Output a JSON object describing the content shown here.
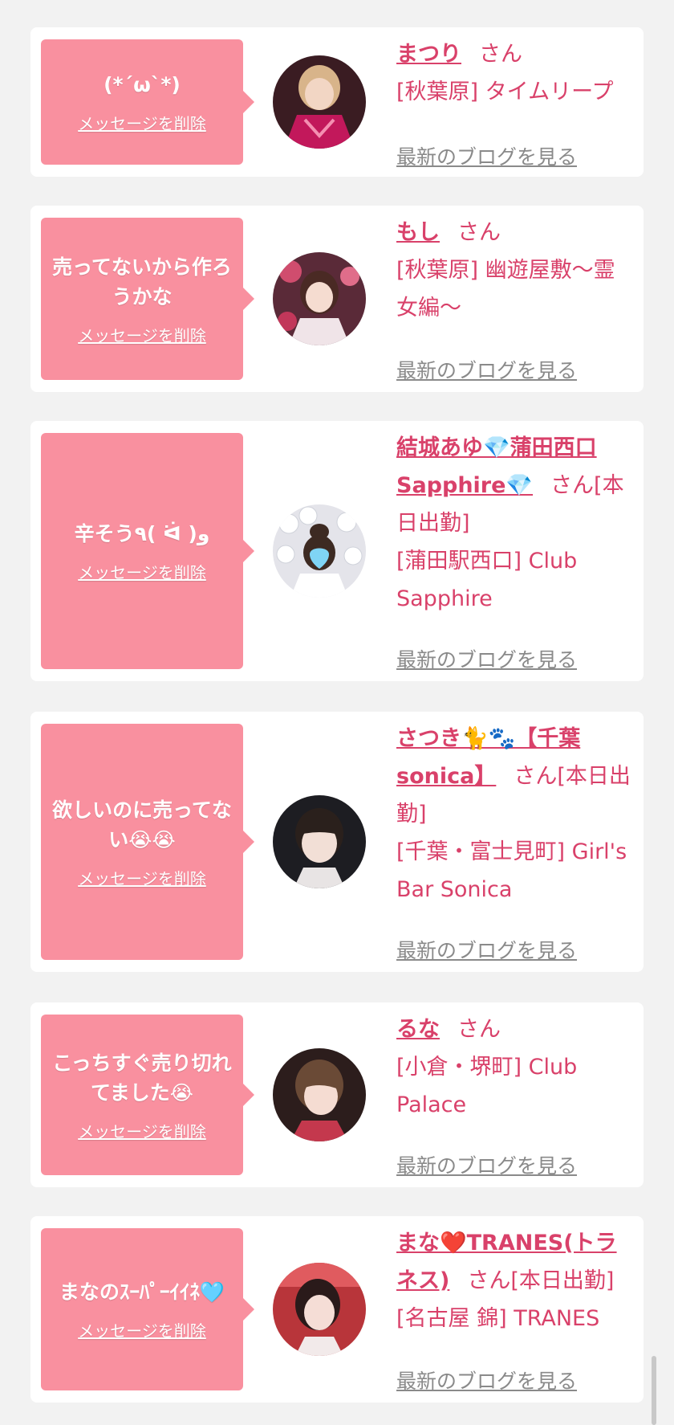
{
  "delete_label": "メッセージを削除",
  "blog_label": "最新のブログを見る",
  "san_label": "さん",
  "colors": {
    "bubble": "#f9909f",
    "accent": "#d9416a",
    "blog_link": "#8a8a8a",
    "background": "#f2f2f2"
  },
  "cards": [
    {
      "message": "(*´ω`*)",
      "name": "まつり",
      "san_suffix": "さん",
      "shop": "[秋葉原] タイムリープ"
    },
    {
      "message": "売ってないから作ろうかな",
      "name": "もし",
      "san_suffix": "さん",
      "shop": "[秋葉原] 幽遊屋敷〜霊女編〜"
    },
    {
      "message": "辛そう٩( ᐛ )و",
      "name": "結城あゆ💎蒲田西口Sapphire💎",
      "san_suffix": "さん[本日出勤]",
      "shop": "[蒲田駅西口] Club Sapphire"
    },
    {
      "message": "欲しいのに売ってない😭😭",
      "name": "さつき🐈🐾【千葉sonica】",
      "san_suffix": "さん[本日出勤]",
      "shop": "[千葉・富士見町] Girl's Bar Sonica"
    },
    {
      "message": "こっちすぐ売り切れてました😭",
      "name": "るな",
      "san_suffix": "さん",
      "shop": "[小倉・堺町] Club Palace"
    },
    {
      "message": "まなのｽｰﾊﾟｰｲｲﾈ🩵",
      "name": "まな❤️TRANES(トラネス)",
      "san_suffix": "さん[本日出勤]",
      "shop": "[名古屋 錦] TRANES"
    }
  ]
}
